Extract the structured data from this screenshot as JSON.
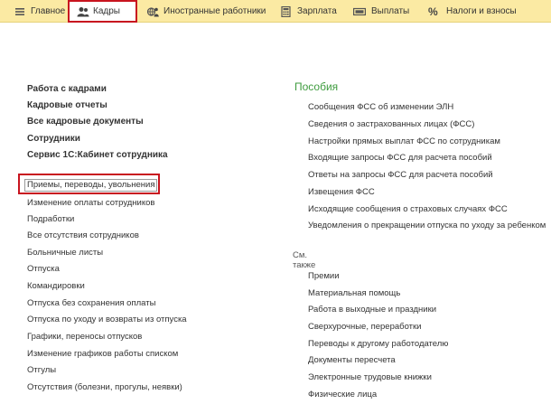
{
  "topbar": {
    "tabs": [
      {
        "label": "Главное",
        "icon": "list-lines-icon",
        "active": false,
        "highlighted": false
      },
      {
        "label": "Кадры",
        "icon": "people-icon",
        "active": true,
        "highlighted": true
      },
      {
        "label": "Иностранные работники",
        "icon": "globe-person-icon",
        "active": false,
        "highlighted": false
      },
      {
        "label": "Зарплата",
        "icon": "calculator-icon",
        "active": false,
        "highlighted": false
      },
      {
        "label": "Выплаты",
        "icon": "banknote-icon",
        "active": false,
        "highlighted": false
      },
      {
        "label": "Налоги и взносы",
        "icon": "percent-icon",
        "active": false,
        "highlighted": false
      }
    ]
  },
  "left": {
    "bold_items": [
      "Работа с кадрами",
      "Кадровые отчеты",
      "Все кадровые документы",
      "Сотрудники",
      "Сервис 1С:Кабинет сотрудника"
    ],
    "items": [
      {
        "label": "Приемы, переводы, увольнения",
        "highlighted": true
      },
      {
        "label": "Изменение оплаты сотрудников",
        "highlighted": false
      },
      {
        "label": "Подработки",
        "highlighted": false
      },
      {
        "label": "Все отсутствия сотрудников",
        "highlighted": false
      },
      {
        "label": "Больничные листы",
        "highlighted": false
      },
      {
        "label": "Отпуска",
        "highlighted": false
      },
      {
        "label": "Командировки",
        "highlighted": false
      },
      {
        "label": "Отпуска без сохранения оплаты",
        "highlighted": false
      },
      {
        "label": "Отпуска по уходу и возвраты из отпуска",
        "highlighted": false
      },
      {
        "label": "Графики, переносы отпусков",
        "highlighted": false
      },
      {
        "label": "Изменение графиков работы списком",
        "highlighted": false
      },
      {
        "label": "Отгулы",
        "highlighted": false
      },
      {
        "label": "Отсутствия (болезни, прогулы, неявки)",
        "highlighted": false
      }
    ]
  },
  "right": {
    "benefits_heading": "Пособия",
    "benefits_items": [
      "Сообщения ФСС об изменении ЭЛН",
      "Сведения о застрахованных лицах (ФСС)",
      "Настройки прямых выплат ФСС по сотрудникам",
      "Входящие запросы ФСС для расчета пособий",
      "Ответы на запросы ФСС для расчета пособий",
      "Извещения ФСС",
      "Исходящие сообщения о страховых случаях ФСС",
      "Уведомления о прекращении отпуска по уходу за ребенком"
    ],
    "see_also_heading": "См. также",
    "see_also_items": [
      "Премии",
      "Материальная помощь",
      "Работа в выходные и праздники",
      "Сверхурочные, переработки",
      "Переводы к другому работодателю",
      "Документы пересчета",
      "Электронные трудовые книжки",
      "Физические лица"
    ]
  },
  "colors": {
    "topbar_bg": "#fbeaa3",
    "highlight_red": "#c8141f",
    "heading_green": "#3f9c3f",
    "text": "#333333"
  }
}
